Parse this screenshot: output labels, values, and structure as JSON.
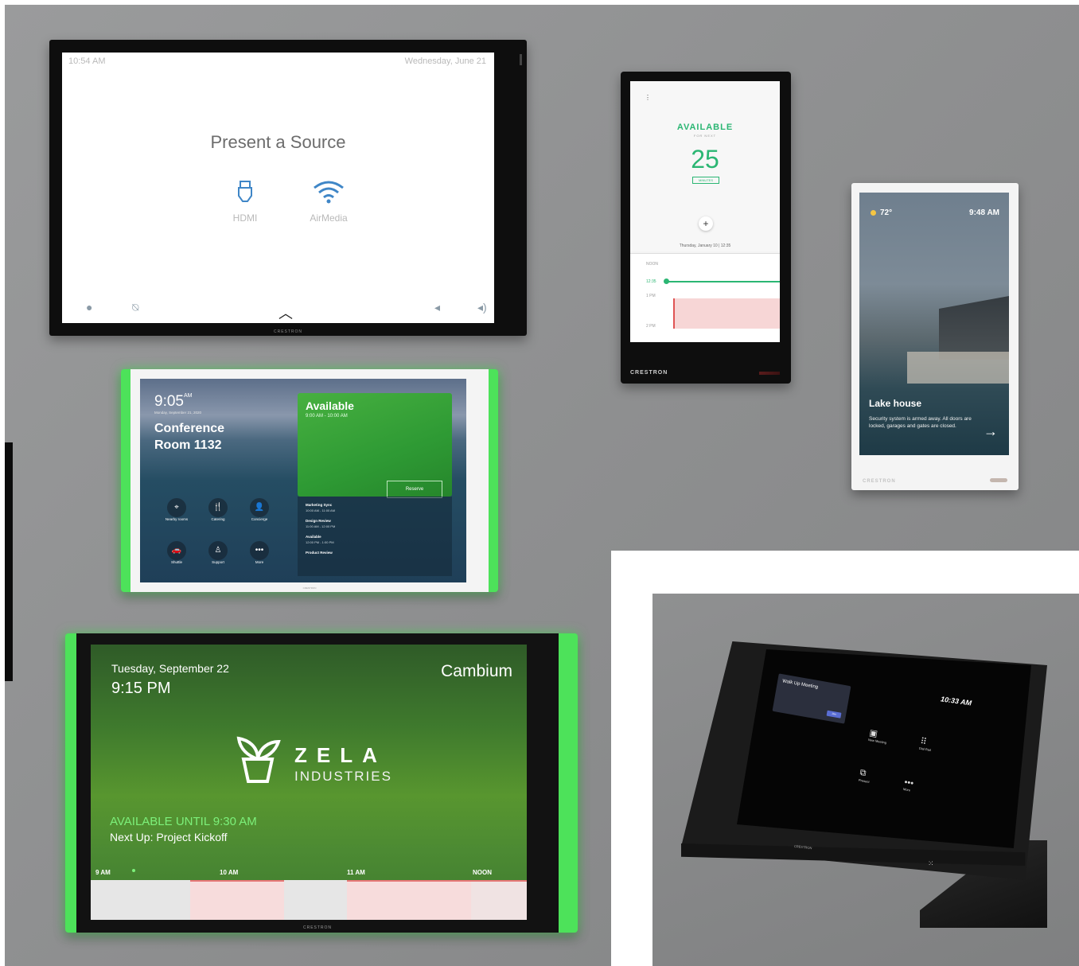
{
  "panel_presentation": {
    "time": "10:54 AM",
    "date": "Wednesday, June 21",
    "title": "Present a Source",
    "sources": [
      {
        "label": "HDMI",
        "icon": "hdmi-icon"
      },
      {
        "label": "AirMedia",
        "icon": "wifi-icon"
      }
    ],
    "brand": "CRESTRON"
  },
  "panel_availability": {
    "status": "AVAILABLE",
    "for_next": "FOR NEXT",
    "minutes_value": "25",
    "minutes_label": "MINUTES",
    "plus": "+",
    "date_line": "Thursday, January 10 | 12:35",
    "timeline": [
      "NOON",
      "12:35",
      "1 PM",
      "2 PM"
    ],
    "brand": "CRESTRON",
    "colors": {
      "accent": "#2bb673",
      "busy": "#f7d6d6"
    }
  },
  "panel_home": {
    "temperature": "72°",
    "time": "9:48 AM",
    "title": "Lake house",
    "description": "Security system is armed away. All doors are locked, garages and gates are closed.",
    "arrow": "→",
    "brand": "CRESTRON"
  },
  "panel_conference": {
    "time": "9:05",
    "ampm": "AM",
    "date": "Monday, September 21, 2020",
    "room_line1": "Conference",
    "room_line2": "Room 1132",
    "card_status": "Available",
    "card_time": "9:00 AM - 10:00 AM",
    "reserve_label": "Reserve",
    "schedule": [
      {
        "title": "Marketing Sync",
        "time": "10:00 AM - 11:00 AM"
      },
      {
        "title": "Design Review",
        "time": "11:00 AM - 12:00 PM"
      },
      {
        "title": "Available",
        "time": "12:00 PM - 1:00 PM"
      },
      {
        "title": "Product Review",
        "time": ""
      }
    ],
    "services": [
      {
        "label": "Nearby rooms",
        "icon": "location-pin-icon",
        "glyph": "⌖"
      },
      {
        "label": "Catering",
        "icon": "utensils-icon",
        "glyph": "🍴"
      },
      {
        "label": "Concierge",
        "icon": "concierge-icon",
        "glyph": "👤"
      },
      {
        "label": "Shuttle",
        "icon": "car-icon",
        "glyph": "🚗"
      },
      {
        "label": "Support",
        "icon": "support-icon",
        "glyph": "♙"
      },
      {
        "label": "More",
        "icon": "more-icon",
        "glyph": "•••"
      }
    ],
    "brand": "CRESTRON",
    "colors": {
      "led": "#4de25a",
      "card": "#3aa83a"
    }
  },
  "panel_zela": {
    "date": "Tuesday, September 22",
    "time": "9:15 PM",
    "room": "Cambium",
    "logo_word": "ZELA",
    "logo_sub": "INDUSTRIES",
    "availability": "AVAILABLE UNTIL 9:30 AM",
    "next_up": "Next Up: Project Kickoff",
    "timeline_labels": [
      "9 AM",
      "10 AM",
      "11 AM",
      "NOON"
    ],
    "brand": "CRESTRON",
    "colors": {
      "available_text": "#7cf07a",
      "led": "#4de25a"
    }
  },
  "panel_tabletop": {
    "card_title": "Walk Up Meeting",
    "card_button": "Join",
    "clock": "10:33 AM",
    "actions": [
      {
        "label": "New Meeting",
        "icon": "video-icon",
        "glyph": "▣"
      },
      {
        "label": "Dial Pad",
        "icon": "dialpad-icon",
        "glyph": "⠿"
      },
      {
        "label": "Present",
        "icon": "present-icon",
        "glyph": "⧉"
      },
      {
        "label": "More",
        "icon": "more-icon",
        "glyph": "•••"
      }
    ],
    "brand": "CRESTRON"
  }
}
